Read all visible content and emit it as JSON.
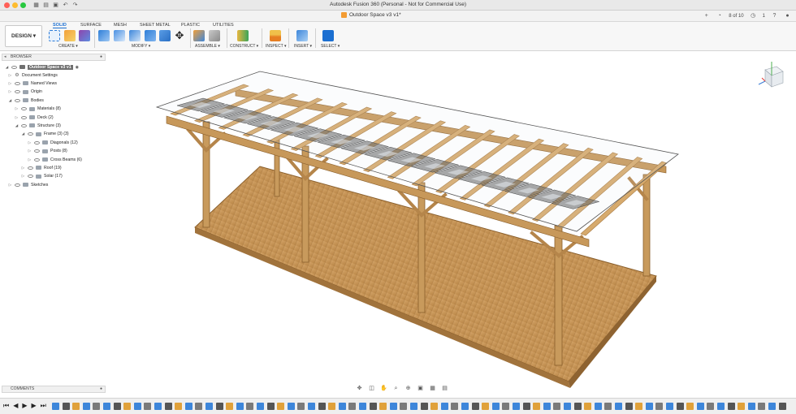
{
  "window": {
    "title": "Autodesk Fusion 360 (Personal - Not for Commercial Use)",
    "traffic_colors": [
      "#ff5f57",
      "#febc2e",
      "#28c840"
    ]
  },
  "document_tab": {
    "name": "Outdoor Space v3 v1*"
  },
  "header_right": {
    "job_status": "8 of 10",
    "notifications": "1"
  },
  "toolbar": {
    "design_label": "DESIGN ▾",
    "workspace_tabs": [
      "SOLID",
      "SURFACE",
      "MESH",
      "SHEET METAL",
      "PLASTIC",
      "UTILITIES"
    ],
    "groups": [
      "CREATE ▾",
      "MODIFY ▾",
      "ASSEMBLE ▾",
      "CONSTRUCT ▾",
      "INSPECT ▾",
      "INSERT ▾",
      "SELECT ▾"
    ]
  },
  "browser": {
    "title": "BROWSER",
    "root": "Outdoor Space v3 v1",
    "items": [
      {
        "label": "Document Settings",
        "depth": 1,
        "kind": "gear"
      },
      {
        "label": "Named Views",
        "depth": 1,
        "kind": "folder"
      },
      {
        "label": "Origin",
        "depth": 1,
        "kind": "folder"
      },
      {
        "label": "Bodies",
        "depth": 1,
        "kind": "folder"
      },
      {
        "label": "Materials (8)",
        "depth": 2,
        "kind": "folder"
      },
      {
        "label": "Deck (2)",
        "depth": 2,
        "kind": "folder"
      },
      {
        "label": "Structure (3)",
        "depth": 2,
        "kind": "folder"
      },
      {
        "label": "Frame (3) (3)",
        "depth": 3,
        "kind": "folder"
      },
      {
        "label": "Diagonals (12)",
        "depth": 4,
        "kind": "folder"
      },
      {
        "label": "Posts (8)",
        "depth": 4,
        "kind": "folder"
      },
      {
        "label": "Cross Beams (6)",
        "depth": 4,
        "kind": "folder"
      },
      {
        "label": "Roof (19)",
        "depth": 3,
        "kind": "folder"
      },
      {
        "label": "Solar (17)",
        "depth": 3,
        "kind": "folder"
      },
      {
        "label": "Sketches",
        "depth": 1,
        "kind": "folder"
      }
    ]
  },
  "comments": {
    "title": "COMMENTS"
  },
  "colors": {
    "accent": "#1b6fd1",
    "wood": "#c89a5c",
    "wood_dark": "#a3763f",
    "deck": "#c9985a",
    "panel": "#6b6b6b"
  }
}
